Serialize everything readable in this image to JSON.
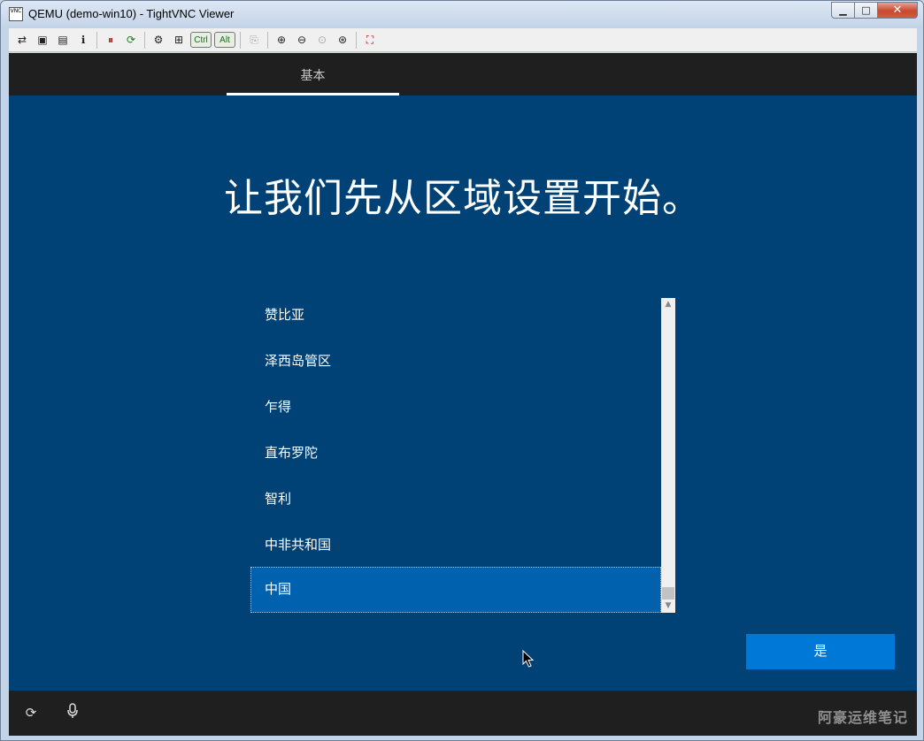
{
  "window": {
    "title": "QEMU (demo-win10) - TightVNC Viewer",
    "app_icon_text": "VNC",
    "minimize_glyph": "▁",
    "maximize_glyph": "□",
    "close_glyph": "✕"
  },
  "toolbar": {
    "buttons": [
      {
        "name": "new-connection-icon",
        "glyph": "⇄"
      },
      {
        "name": "save-icon",
        "glyph": "▣"
      },
      {
        "name": "options-icon",
        "glyph": "▤"
      },
      {
        "name": "info-icon",
        "glyph": "ℹ"
      },
      {
        "name": "pause-icon",
        "glyph": "⏸"
      },
      {
        "name": "refresh-icon",
        "glyph": "⟳"
      },
      {
        "name": "ctrl-alt-del-icon",
        "glyph": "⚙"
      },
      {
        "name": "windows-key-icon",
        "glyph": "⊞"
      }
    ],
    "ctrl_label": "Ctrl",
    "alt_label": "Alt",
    "zoom_buttons": [
      {
        "name": "clipboard-icon",
        "glyph": "⎘"
      },
      {
        "name": "zoom-in-icon",
        "glyph": "⊕"
      },
      {
        "name": "zoom-out-icon",
        "glyph": "⊖"
      },
      {
        "name": "zoom-100-icon",
        "glyph": "⊙"
      },
      {
        "name": "zoom-fit-icon",
        "glyph": "⊛"
      },
      {
        "name": "fullscreen-icon",
        "glyph": "⛶"
      }
    ]
  },
  "setup": {
    "tab_label": "基本",
    "heading": "让我们先从区域设置开始。",
    "regions": [
      "赞比亚",
      "泽西岛管区",
      "乍得",
      "直布罗陀",
      "智利",
      "中非共和国",
      "中国"
    ],
    "selected_region": "中国",
    "yes_button": "是",
    "scroll_up_glyph": "▲",
    "scroll_down_glyph": "▼"
  },
  "bottombar": {
    "ease_of_access_glyph": "⟳",
    "microphone_glyph": "🎙",
    "watermark": "阿豪运维笔记"
  },
  "colors": {
    "screen_bg": "#004275",
    "bar_bg": "#1f1f1f",
    "selected_bg": "#0061ae",
    "accent": "#0078d7"
  }
}
